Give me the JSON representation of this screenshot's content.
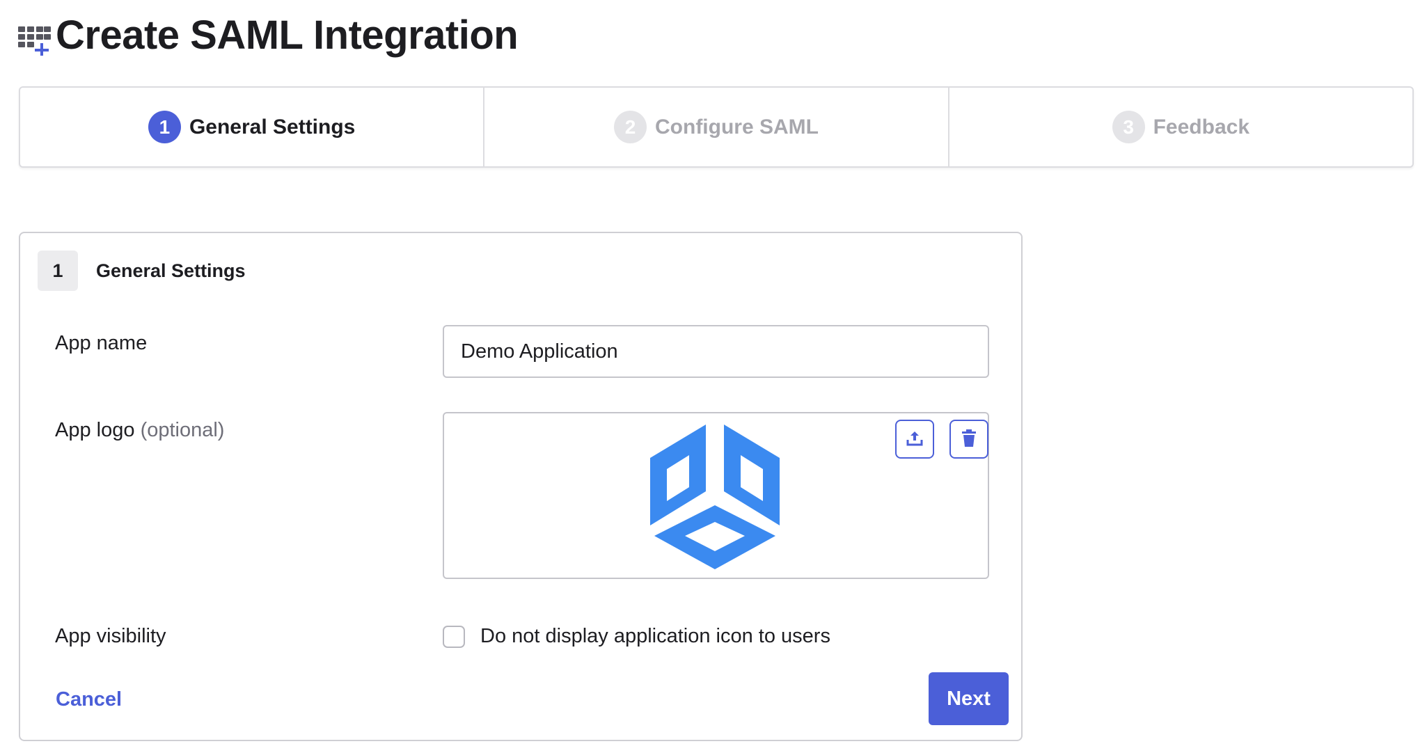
{
  "page": {
    "title": "Create SAML Integration",
    "header_icon": "add-app-grid-icon"
  },
  "stepper": {
    "steps": [
      {
        "number": "1",
        "label": "General Settings",
        "state": "active"
      },
      {
        "number": "2",
        "label": "Configure SAML",
        "state": "inactive"
      },
      {
        "number": "3",
        "label": "Feedback",
        "state": "inactive"
      }
    ]
  },
  "card": {
    "step_number": "1",
    "title": "General Settings",
    "app_name": {
      "label": "App name",
      "value": "Demo Application"
    },
    "app_logo": {
      "label": "App logo",
      "optional_text": "(optional)",
      "upload_icon": "upload-icon",
      "delete_icon": "trash-icon"
    },
    "app_visibility": {
      "label": "App visibility",
      "checkbox_label": "Do not display application icon to users",
      "checked": false
    },
    "cancel_label": "Cancel",
    "next_label": "Next"
  },
  "colors": {
    "accent": "#4b5fd8",
    "logo_blue": "#3b8af0",
    "inactive_step": "#a7a7ad",
    "border": "#cfcfd4"
  }
}
